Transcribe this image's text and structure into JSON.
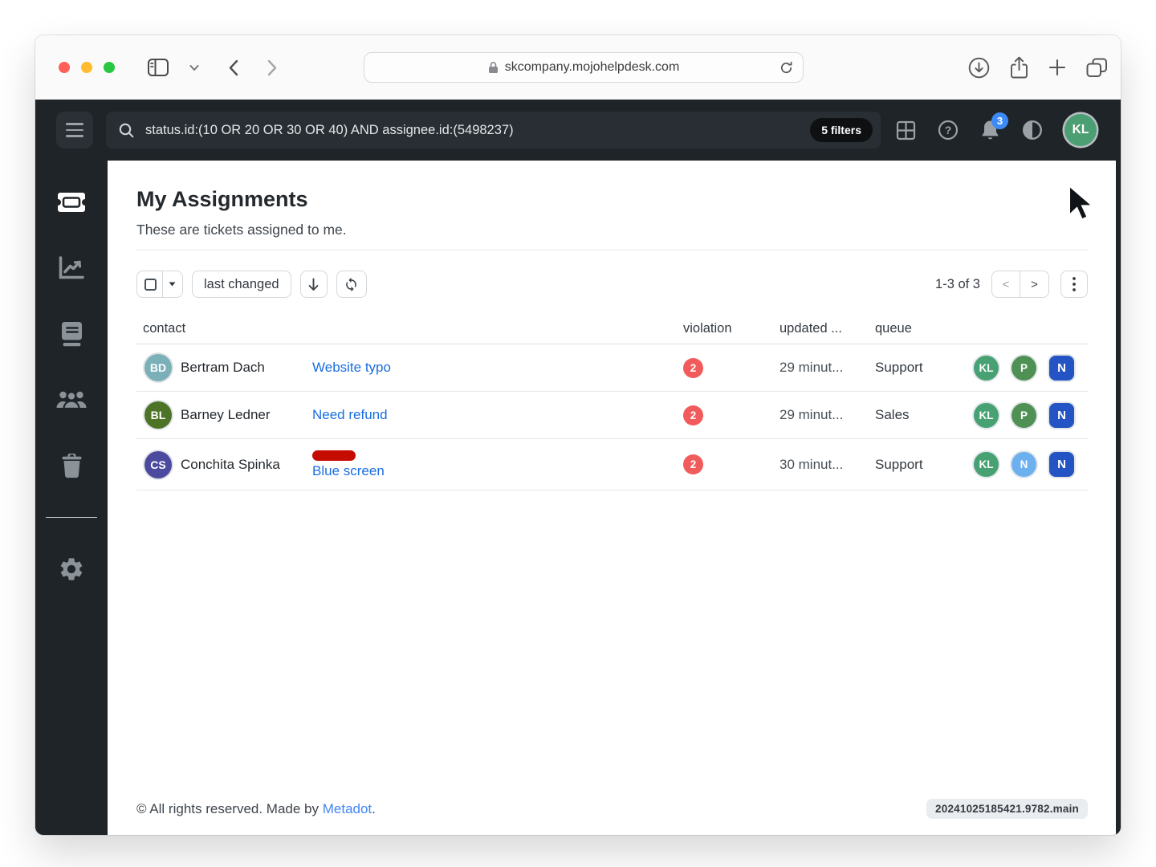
{
  "browser": {
    "url": "skcompany.mojohelpdesk.com"
  },
  "topbar": {
    "search": {
      "query": "status.id:(10 OR 20 OR 30 OR 40) AND assignee.id:(5498237)",
      "filters_label": "5 filters"
    },
    "notifications": {
      "count": "3",
      "badge_color": "#3d8af7"
    },
    "avatar": {
      "initials": "KL",
      "color": "#4c9f72"
    }
  },
  "icons": {
    "browser": [
      "sidebar-toggle",
      "tab-chevron-down",
      "back",
      "forward",
      "lock",
      "reload",
      "download",
      "share",
      "new-tab",
      "tabs-overview"
    ],
    "app_topbar": [
      "menu",
      "search",
      "apps-grid",
      "help",
      "notifications",
      "theme-contrast"
    ],
    "sidebar": [
      "tickets",
      "reports",
      "knowledge-base",
      "contacts",
      "trash",
      "settings"
    ],
    "toolbar": [
      "select-checkbox",
      "dropdown-caret",
      "sort-descending",
      "refresh",
      "previous",
      "next",
      "more-options"
    ]
  },
  "page": {
    "title": "My Assignments",
    "subtitle": "These are tickets assigned to me.",
    "toolbar": {
      "sort_label": "last changed",
      "range_label": "1-3 of 3",
      "prev_label": "<",
      "next_label": ">"
    },
    "table": {
      "headers": {
        "contact": "contact",
        "violation": "violation",
        "updated": "updated ...",
        "queue": "queue"
      },
      "rows": [
        {
          "avatar": {
            "initials": "BD",
            "color": "#7cb0b9"
          },
          "name": "Bertram Dach",
          "subject": "Website typo",
          "violation": {
            "count": "2",
            "color": "#f15b5b"
          },
          "updated": "29 minut...",
          "queue": "Support",
          "assignees": [
            {
              "label": "KL",
              "color": "#47a173"
            },
            {
              "label": "P",
              "color": "#4f9054"
            },
            {
              "label": "N",
              "color": "#2453c4"
            }
          ]
        },
        {
          "avatar": {
            "initials": "BL",
            "color": "#4d7327"
          },
          "name": "Barney Ledner",
          "subject": "Need refund",
          "violation": {
            "count": "2",
            "color": "#f15b5b"
          },
          "updated": "29 minut...",
          "queue": "Sales",
          "assignees": [
            {
              "label": "KL",
              "color": "#47a173"
            },
            {
              "label": "P",
              "color": "#4f9054"
            },
            {
              "label": "N",
              "color": "#2453c4"
            }
          ]
        },
        {
          "avatar": {
            "initials": "CS",
            "color": "#4c4a9e"
          },
          "name": "Conchita Spinka",
          "subject": "Blue screen",
          "tag_color": "#c60b00",
          "violation": {
            "count": "2",
            "color": "#f15b5b"
          },
          "updated": "30 minut...",
          "queue": "Support",
          "assignees": [
            {
              "label": "KL",
              "color": "#47a173"
            },
            {
              "label": "N",
              "color": "#6db0ef"
            },
            {
              "label": "N",
              "color": "#2453c4"
            }
          ]
        }
      ]
    },
    "footer": {
      "copyright_prefix": "© All rights reserved. Made by ",
      "credit_link": "Metadot",
      "suffix": ".",
      "version": "20241025185421.9782.main"
    }
  }
}
